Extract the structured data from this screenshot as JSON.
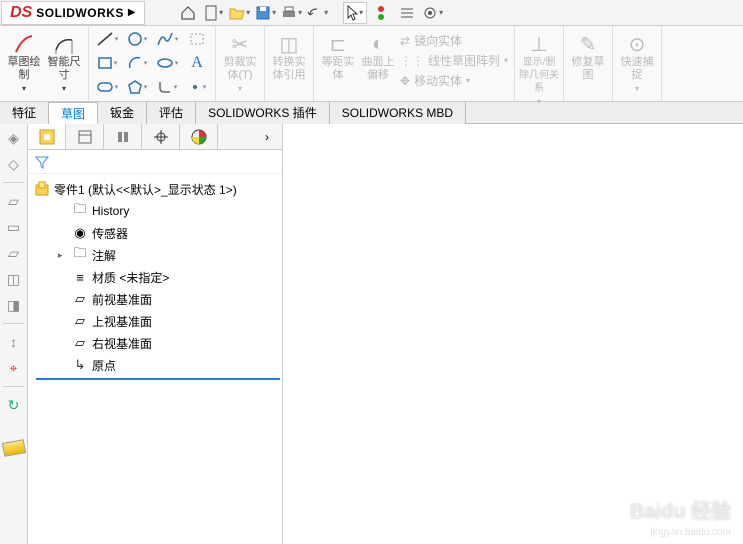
{
  "app": {
    "name": "SOLIDWORKS"
  },
  "ribbon": {
    "sketch_make": "草图绘制",
    "smart_dim": "智能尺寸",
    "cut": "剪裁实体(T)",
    "convert": "转换实体引用",
    "offset": "等距实体",
    "face_offset": "曲面上偏移",
    "mirror": "镜向实体",
    "pattern": "线性草图阵列",
    "move": "移动实体",
    "show_del_rel": "显示/删除几何关系",
    "repair": "修复草图",
    "snap": "快速捕捉"
  },
  "tabs": [
    "特征",
    "草图",
    "钣金",
    "评估",
    "SOLIDWORKS 插件",
    "SOLIDWORKS MBD"
  ],
  "active_tab": "草图",
  "tree": {
    "root": "零件1 (默认<<默认>_显示状态 1>)",
    "items": [
      {
        "label": "History",
        "icon": "folder"
      },
      {
        "label": "传感器",
        "icon": "sensor"
      },
      {
        "label": "注解",
        "icon": "folder",
        "expandable": true
      },
      {
        "label": "材质 <未指定>",
        "icon": "material"
      },
      {
        "label": "前视基准面",
        "icon": "plane"
      },
      {
        "label": "上视基准面",
        "icon": "plane"
      },
      {
        "label": "右视基准面",
        "icon": "plane"
      },
      {
        "label": "原点",
        "icon": "origin"
      }
    ]
  },
  "watermark": {
    "main": "Baidu 经验",
    "sub": "jingyan.baidu.com"
  }
}
